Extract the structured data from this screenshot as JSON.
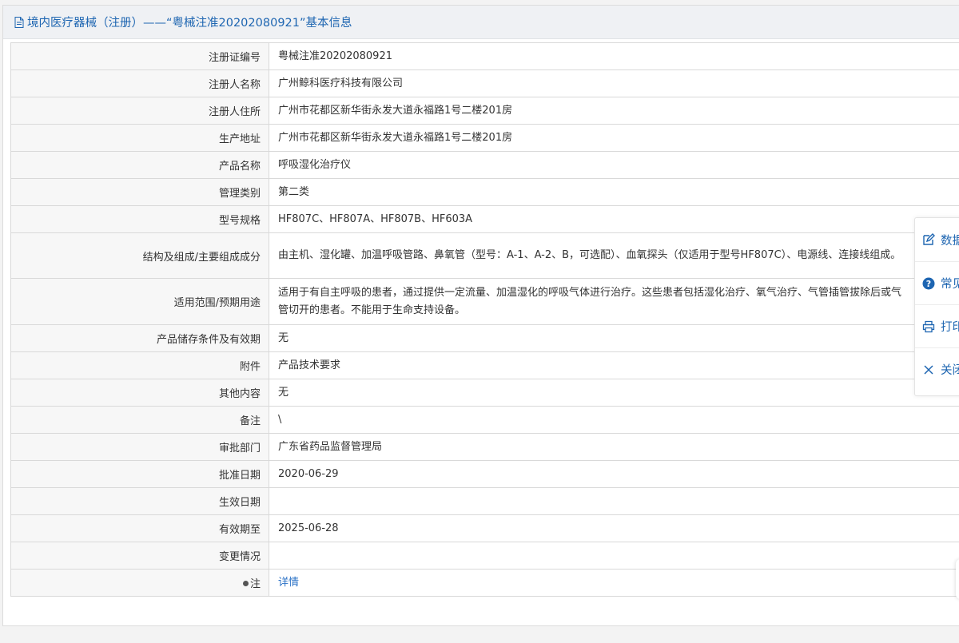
{
  "header": {
    "title": "境内医疗器械（注册）——“粤械注准20202080921”基本信息"
  },
  "rows": [
    {
      "label": "注册证编号",
      "value": "粤械注准20202080921"
    },
    {
      "label": "注册人名称",
      "value": "广州鲸科医疗科技有限公司"
    },
    {
      "label": "注册人住所",
      "value": "广州市花都区新华街永发大道永福路1号二楼201房"
    },
    {
      "label": "生产地址",
      "value": "广州市花都区新华街永发大道永福路1号二楼201房"
    },
    {
      "label": "产品名称",
      "value": "呼吸湿化治疗仪"
    },
    {
      "label": "管理类别",
      "value": "第二类"
    },
    {
      "label": "型号规格",
      "value": "HF807C、HF807A、HF807B、HF603A"
    },
    {
      "label": "结构及组成/主要组成成分",
      "value": "由主机、湿化罐、加温呼吸管路、鼻氧管（型号：A-1、A-2、B，可选配）、血氧探头（仅适用于型号HF807C）、电源线、连接线组成。"
    },
    {
      "label": "适用范围/预期用途",
      "value": "适用于有自主呼吸的患者，通过提供一定流量、加温湿化的呼吸气体进行治疗。这些患者包括湿化治疗、氧气治疗、气管插管拔除后或气管切开的患者。不能用于生命支持设备。"
    },
    {
      "label": "产品储存条件及有效期",
      "value": "无"
    },
    {
      "label": "附件",
      "value": "产品技术要求"
    },
    {
      "label": "其他内容",
      "value": "无"
    },
    {
      "label": "备注",
      "value": "\\"
    },
    {
      "label": "审批部门",
      "value": "广东省药品监督管理局"
    },
    {
      "label": "批准日期",
      "value": "2020-06-29"
    },
    {
      "label": "生效日期",
      "value": ""
    },
    {
      "label": "有效期至",
      "value": "2025-06-28"
    },
    {
      "label": "变更情况",
      "value": ""
    },
    {
      "label": "注",
      "value": "详情"
    }
  ],
  "toolbar": {
    "items": [
      {
        "label": "数据",
        "icon": "edit-icon"
      },
      {
        "label": "常见",
        "icon": "help-icon"
      },
      {
        "label": "打印",
        "icon": "print-icon"
      },
      {
        "label": "关闭",
        "icon": "close-icon"
      }
    ]
  }
}
